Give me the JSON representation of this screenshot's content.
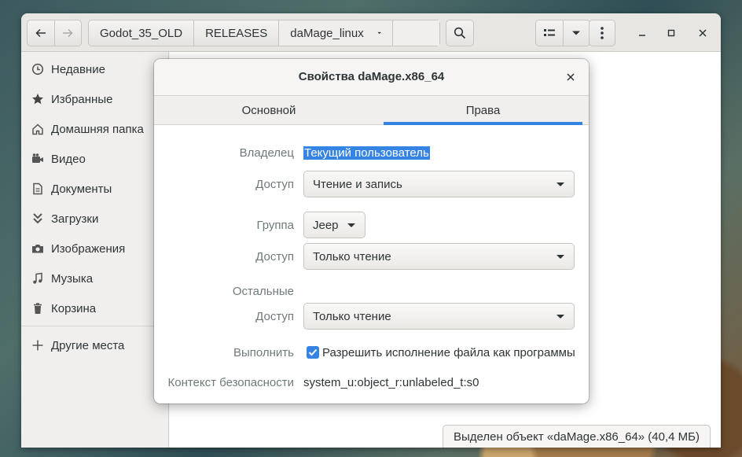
{
  "headerbar": {
    "breadcrumbs": [
      "Godot_35_OLD",
      "RELEASES",
      "daMage_linux"
    ]
  },
  "sidebar": {
    "items": [
      {
        "label": "Недавние",
        "icon": "clock-icon"
      },
      {
        "label": "Избранные",
        "icon": "star-icon"
      },
      {
        "label": "Домашняя папка",
        "icon": "home-icon"
      },
      {
        "label": "Видео",
        "icon": "video-icon"
      },
      {
        "label": "Документы",
        "icon": "document-icon"
      },
      {
        "label": "Загрузки",
        "icon": "download-icon"
      },
      {
        "label": "Изображения",
        "icon": "camera-icon"
      },
      {
        "label": "Музыка",
        "icon": "music-icon"
      },
      {
        "label": "Корзина",
        "icon": "trash-icon"
      }
    ],
    "other_places": "Другие места"
  },
  "statusbar": {
    "text": "Выделен объект «daMage.x86_64» (40,4 МБ)"
  },
  "dialog": {
    "title": "Свойства daMage.x86_64",
    "tabs": [
      "Основной",
      "Права"
    ],
    "active_tab": "Права",
    "owner_label": "Владелец",
    "owner_value": "Текущий пользователь",
    "owner_access_label": "Доступ",
    "owner_access_value": "Чтение и запись",
    "group_label": "Группа",
    "group_value": "Jeep",
    "group_access_label": "Доступ",
    "group_access_value": "Только чтение",
    "others_label": "Остальные",
    "others_access_label": "Доступ",
    "others_access_value": "Только чтение",
    "execute_label": "Выполнить",
    "execute_checkbox_label": "Разрешить исполнение файла как программы",
    "execute_checked": true,
    "security_label": "Контекст безопасности",
    "security_value": "system_u:object_r:unlabeled_t:s0"
  },
  "colors": {
    "accent": "#3584e4"
  }
}
